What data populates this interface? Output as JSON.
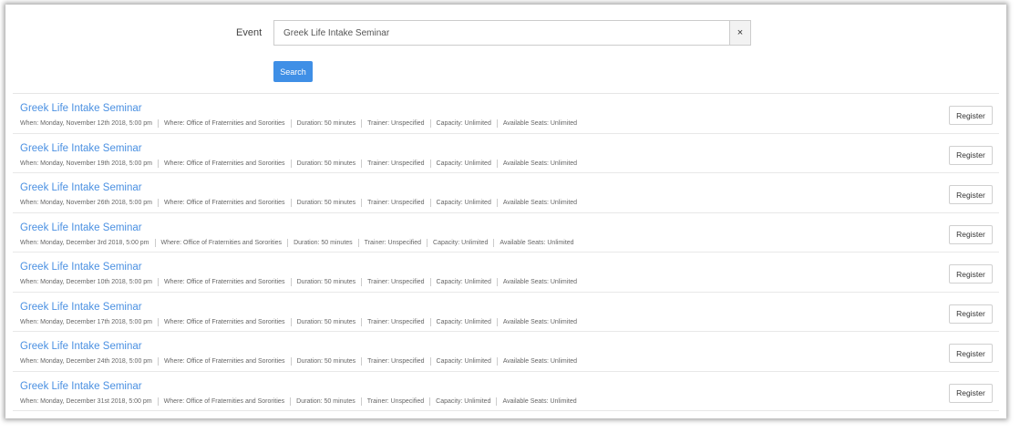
{
  "search": {
    "label": "Event",
    "value": "Greek Life Intake Seminar",
    "clear_icon": "×",
    "button_label": "Search"
  },
  "results": [
    {
      "title": "Greek Life Intake Seminar",
      "when": "When: Monday, November 12th 2018, 5:00 pm",
      "where": "Where: Office of Fraternities and Sororities",
      "duration": "Duration: 50 minutes",
      "trainer": "Trainer: Unspecified",
      "capacity": "Capacity: Unlimited",
      "seats": "Available Seats: Unlimited",
      "button": "Register"
    },
    {
      "title": "Greek Life Intake Seminar",
      "when": "When: Monday, November 19th 2018, 5:00 pm",
      "where": "Where: Office of Fraternities and Sororities",
      "duration": "Duration: 50 minutes",
      "trainer": "Trainer: Unspecified",
      "capacity": "Capacity: Unlimited",
      "seats": "Available Seats: Unlimited",
      "button": "Register"
    },
    {
      "title": "Greek Life Intake Seminar",
      "when": "When: Monday, November 26th 2018, 5:00 pm",
      "where": "Where: Office of Fraternities and Sororities",
      "duration": "Duration: 50 minutes",
      "trainer": "Trainer: Unspecified",
      "capacity": "Capacity: Unlimited",
      "seats": "Available Seats: Unlimited",
      "button": "Register"
    },
    {
      "title": "Greek Life Intake Seminar",
      "when": "When: Monday, December 3rd 2018, 5:00 pm",
      "where": "Where: Office of Fraternities and Sororities",
      "duration": "Duration: 50 minutes",
      "trainer": "Trainer: Unspecified",
      "capacity": "Capacity: Unlimited",
      "seats": "Available Seats: Unlimited",
      "button": "Register"
    },
    {
      "title": "Greek Life Intake Seminar",
      "when": "When: Monday, December 10th 2018, 5:00 pm",
      "where": "Where: Office of Fraternities and Sororities",
      "duration": "Duration: 50 minutes",
      "trainer": "Trainer: Unspecified",
      "capacity": "Capacity: Unlimited",
      "seats": "Available Seats: Unlimited",
      "button": "Register"
    },
    {
      "title": "Greek Life Intake Seminar",
      "when": "When: Monday, December 17th 2018, 5:00 pm",
      "where": "Where: Office of Fraternities and Sororities",
      "duration": "Duration: 50 minutes",
      "trainer": "Trainer: Unspecified",
      "capacity": "Capacity: Unlimited",
      "seats": "Available Seats: Unlimited",
      "button": "Register"
    },
    {
      "title": "Greek Life Intake Seminar",
      "when": "When: Monday, December 24th 2018, 5:00 pm",
      "where": "Where: Office of Fraternities and Sororities",
      "duration": "Duration: 50 minutes",
      "trainer": "Trainer: Unspecified",
      "capacity": "Capacity: Unlimited",
      "seats": "Available Seats: Unlimited",
      "button": "Register"
    },
    {
      "title": "Greek Life Intake Seminar",
      "when": "When: Monday, December 31st 2018, 5:00 pm",
      "where": "Where: Office of Fraternities and Sororities",
      "duration": "Duration: 50 minutes",
      "trainer": "Trainer: Unspecified",
      "capacity": "Capacity: Unlimited",
      "seats": "Available Seats: Unlimited",
      "button": "Register"
    }
  ]
}
